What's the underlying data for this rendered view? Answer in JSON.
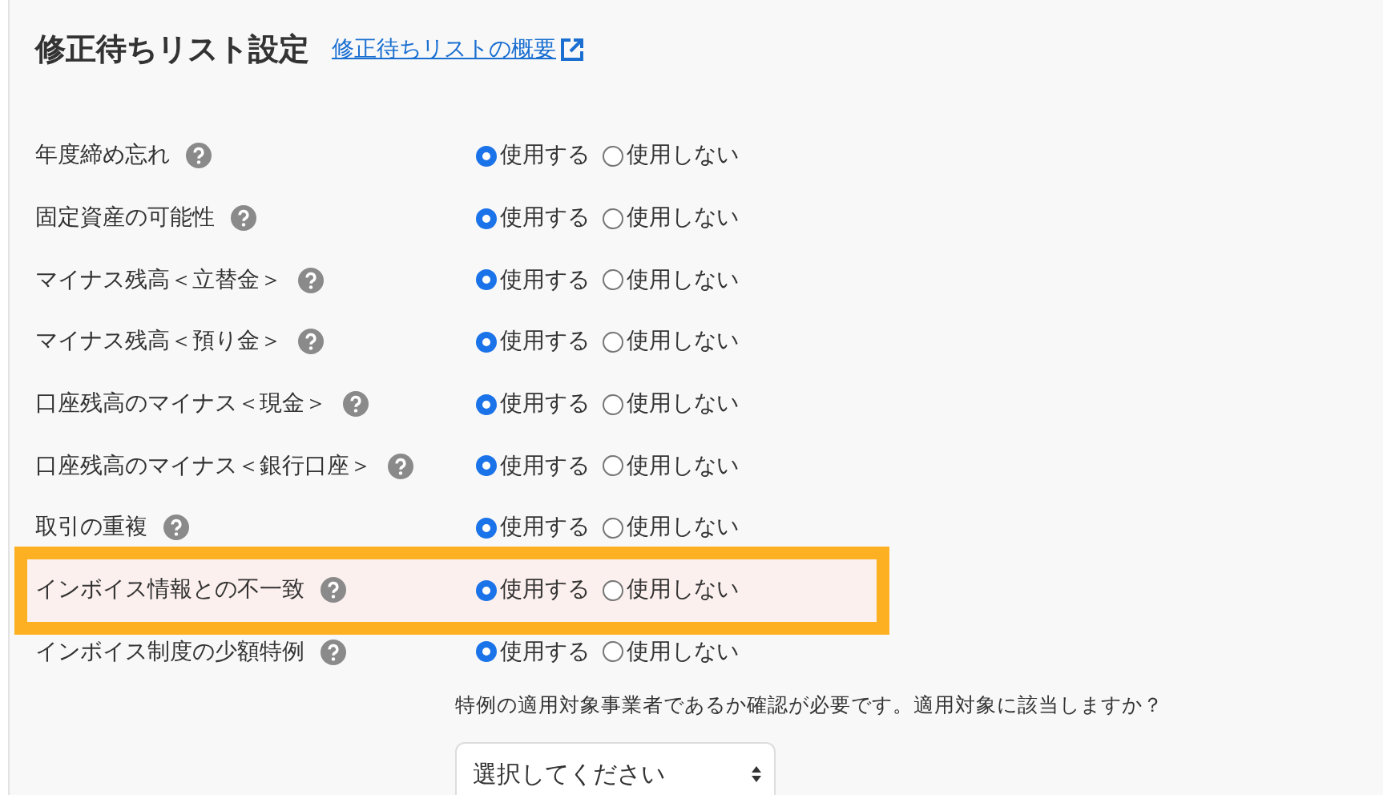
{
  "title": "修正待ちリスト設定",
  "overview_link": "修正待ちリストの概要",
  "rows": [
    {
      "label": "年度締め忘れ",
      "highlighted": false,
      "options": [
        {
          "label": "使用する",
          "selected": true
        },
        {
          "label": "使用しない",
          "selected": false
        }
      ]
    },
    {
      "label": "固定資産の可能性",
      "highlighted": false,
      "options": [
        {
          "label": "使用する",
          "selected": true
        },
        {
          "label": "使用しない",
          "selected": false
        }
      ]
    },
    {
      "label": "マイナス残高＜立替金＞",
      "highlighted": false,
      "options": [
        {
          "label": "使用する",
          "selected": true
        },
        {
          "label": "使用しない",
          "selected": false
        }
      ]
    },
    {
      "label": "マイナス残高＜預り金＞",
      "highlighted": false,
      "options": [
        {
          "label": "使用する",
          "selected": true
        },
        {
          "label": "使用しない",
          "selected": false
        }
      ]
    },
    {
      "label": "口座残高のマイナス＜現金＞",
      "highlighted": false,
      "options": [
        {
          "label": "使用する",
          "selected": true
        },
        {
          "label": "使用しない",
          "selected": false
        }
      ]
    },
    {
      "label": "口座残高のマイナス＜銀行口座＞",
      "highlighted": false,
      "options": [
        {
          "label": "使用する",
          "selected": true
        },
        {
          "label": "使用しない",
          "selected": false
        }
      ]
    },
    {
      "label": "取引の重複",
      "highlighted": false,
      "options": [
        {
          "label": "使用する",
          "selected": true
        },
        {
          "label": "使用しない",
          "selected": false
        }
      ]
    },
    {
      "label": "インボイス情報との不一致",
      "highlighted": true,
      "options": [
        {
          "label": "使用する",
          "selected": true
        },
        {
          "label": "使用しない",
          "selected": false
        }
      ]
    },
    {
      "label": "インボイス制度の少額特例",
      "highlighted": false,
      "options": [
        {
          "label": "使用する",
          "selected": true
        },
        {
          "label": "使用しない",
          "selected": false
        }
      ]
    }
  ],
  "note": "特例の適用対象事業者であるか確認が必要です。適用対象に該当しますか？",
  "select": {
    "value": "選択してください"
  }
}
